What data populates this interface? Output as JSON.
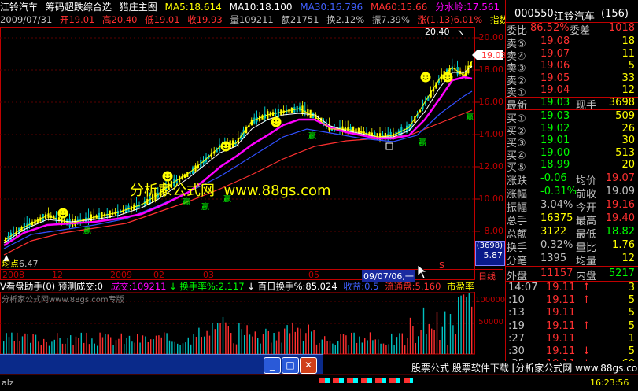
{
  "header": {
    "stock_name": "江铃汽车",
    "formula_name": "筹码超跌综合选",
    "main_chart": "猎庄主图",
    "ma5": "MA5:18.614",
    "ma10": "MA10:18.100",
    "ma30": "MA30:16.796",
    "ma60": "MA60:15.66",
    "watershed": "分水岭:17.561",
    "day_label": "日",
    "date": "2009/07/31",
    "open": "开19.01",
    "high": "高20.40",
    "low": "低19.01",
    "close": "收19.93",
    "volume": "量109211",
    "amount": "额21751",
    "turnover": "换2.12%",
    "amplitude": "振7.39%",
    "change": "涨(1.13)6.01%",
    "indicator": "指数"
  },
  "main_chart": {
    "price_ticks": [
      "20.00",
      "18.00",
      "16.00",
      "14.00",
      "12.00",
      "10.00",
      "8.00"
    ],
    "peak_label": "20.40",
    "low_label": "6.47",
    "low_prefix": "均点",
    "current_price": "19.03",
    "watermark": "分析家公式网  www.88gs.com",
    "date_labels": [
      "2008",
      "12",
      "2009",
      "02",
      "03",
      "05",
      "09/07/06,一"
    ],
    "volume_box_top": "(3698)",
    "volume_box_bottom": "5.87",
    "s_marker": "S",
    "day_line_label": "日线",
    "signal_label": "赢"
  },
  "sub_chart": {
    "title": "V看盘助手(0) 预测成交:0",
    "volume": "成交:109211",
    "turnover_rate": "换手率%:2.117",
    "hundred_day": "百日换手%:85.024",
    "income": "收益:0.5",
    "float": "流通盘:5.160",
    "pe": "市盈率",
    "watermark": "分析家公式网www.88gs.com专版",
    "vol_ticks": [
      "100000",
      "50000"
    ]
  },
  "right_panel": {
    "code": "000550",
    "name": "江铃汽车",
    "count": "(156)",
    "wei_bi": "委比",
    "wei_bi_value": "86.52%",
    "wei_cha": "委差",
    "wei_cha_value": "1018",
    "sell": [
      {
        "label": "卖⑤",
        "price": "19.08",
        "vol": "18"
      },
      {
        "label": "卖④",
        "price": "19.07",
        "vol": "11"
      },
      {
        "label": "卖③",
        "price": "19.06",
        "vol": "5"
      },
      {
        "label": "卖②",
        "price": "19.05",
        "vol": "33"
      },
      {
        "label": "卖①",
        "price": "19.04",
        "vol": "12"
      }
    ],
    "last_label": "最新",
    "last_value": "19.03",
    "now_label": "现手",
    "now_value": "3698",
    "buy": [
      {
        "label": "买①",
        "price": "19.03",
        "vol": "509"
      },
      {
        "label": "买②",
        "price": "19.02",
        "vol": "26"
      },
      {
        "label": "买③",
        "price": "19.01",
        "vol": "30"
      },
      {
        "label": "买④",
        "price": "19.00",
        "vol": "513"
      },
      {
        "label": "买⑤",
        "price": "18.99",
        "vol": "20"
      }
    ],
    "stats": [
      {
        "l1": "涨跌",
        "v1": "-0.06",
        "l2": "均价",
        "v2": "19.07"
      },
      {
        "l1": "涨幅",
        "v1": "-0.31%",
        "l2": "前收",
        "v2": "19.09"
      },
      {
        "l1": "振幅",
        "v1": "3.04%",
        "l2": "今开",
        "v2": "19.16"
      },
      {
        "l1": "总手",
        "v1": "16375",
        "l2": "最高",
        "v2": "19.40"
      },
      {
        "l1": "总额",
        "v1": "3122",
        "l2": "最低",
        "v2": "18.82"
      },
      {
        "l1": "换手",
        "v1": "0.32%",
        "l2": "量比",
        "v2": "1.76"
      },
      {
        "l1": "分笔",
        "v1": "1395",
        "l2": "均量",
        "v2": "12"
      }
    ],
    "outer_label": "外盘",
    "outer_value": "11157",
    "inner_label": "内盘",
    "inner_value": "5217",
    "ticks": [
      {
        "time": "14:07",
        "price": "19.11",
        "arrow": "↑",
        "vol": "3"
      },
      {
        "time": ":10",
        "price": "19.11",
        "arrow": "↑",
        "vol": "5"
      },
      {
        "time": ":13",
        "price": "19.11",
        "arrow": "",
        "vol": "5"
      },
      {
        "time": ":19",
        "price": "19.11",
        "arrow": "↑",
        "vol": "5"
      },
      {
        "time": ":27",
        "price": "19.11",
        "arrow": "",
        "vol": "1"
      },
      {
        "time": ":30",
        "price": "19.11",
        "arrow": "↓",
        "vol": "5"
      },
      {
        "time": ":35",
        "price": "19.11",
        "arrow": "↓",
        "vol": "60"
      }
    ],
    "clock": "16:23:56"
  },
  "taskbar": {
    "minimize": "_",
    "maximize": "□",
    "close": "✕",
    "status_left": "alz"
  },
  "banner_text": "股票公式 股票软件下载 [分析家公式网 www.88gs.com]",
  "colors": {
    "grid_red": "#c00000",
    "price_red": "#ff3030",
    "price_green": "#00ff00",
    "yellow": "#ffff00",
    "cyan": "#00ffff",
    "magenta": "#ff00ff",
    "ma_white": "#ffffff"
  }
}
